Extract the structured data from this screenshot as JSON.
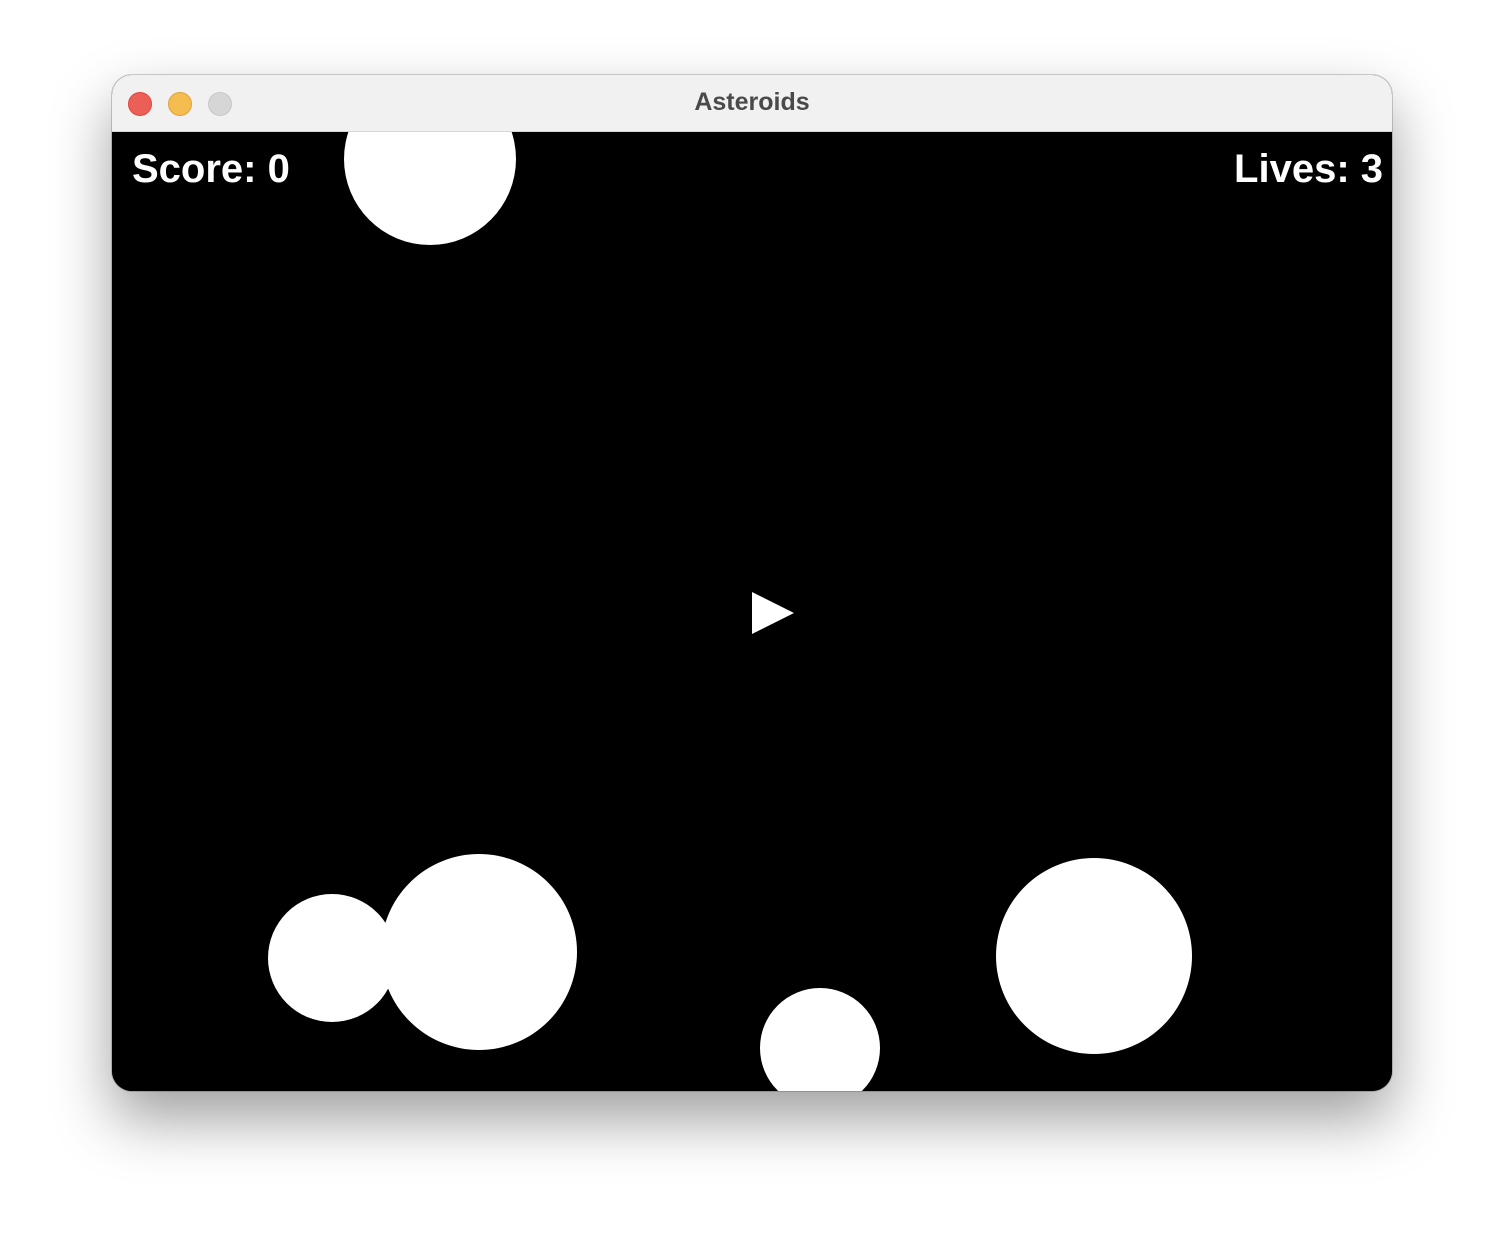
{
  "window": {
    "title": "Asteroids",
    "controls": {
      "close_color": "#ec5f57",
      "minimize_color": "#f5bd4f",
      "zoom_color": "#d6d6d6"
    }
  },
  "hud": {
    "score_text": "Score: 0",
    "lives_text": "Lives: 3"
  },
  "game": {
    "background_color": "#000000",
    "object_color": "#ffffff",
    "ship_icon": "triangle-ship-icon",
    "asteroid_icon": "circle-asteroid-icon",
    "score": 0,
    "lives": 3
  }
}
